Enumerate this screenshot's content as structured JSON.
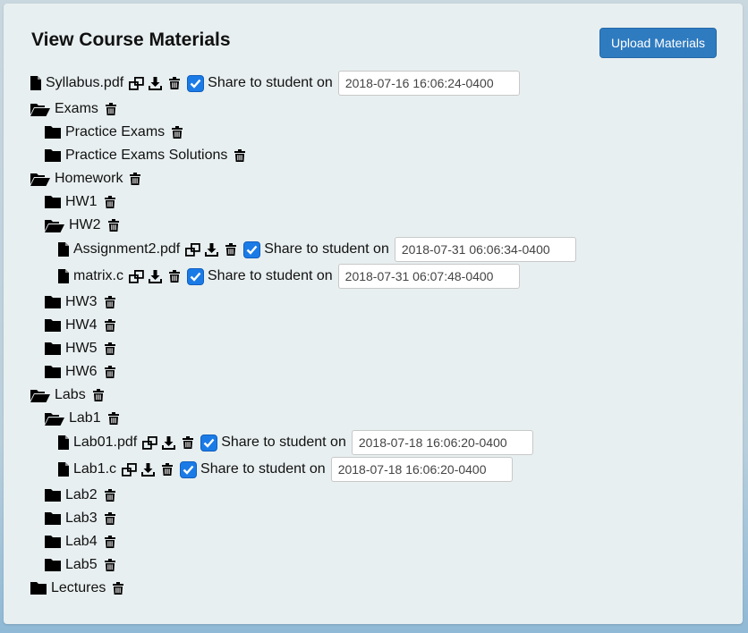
{
  "page": {
    "title": "View Course Materials",
    "upload_label": "Upload Materials"
  },
  "share_label": "Share to student on",
  "tree": {
    "syllabus": {
      "name": "Syllabus.pdf",
      "date": "2018-07-16 16:06:24-0400"
    },
    "exams": {
      "name": "Exams"
    },
    "practice_exams": {
      "name": "Practice Exams"
    },
    "practice_exams_solutions": {
      "name": "Practice Exams Solutions"
    },
    "homework": {
      "name": "Homework"
    },
    "hw1": {
      "name": "HW1"
    },
    "hw2": {
      "name": "HW2"
    },
    "assignment2": {
      "name": "Assignment2.pdf",
      "date": "2018-07-31 06:06:34-0400"
    },
    "matrix": {
      "name": "matrix.c",
      "date": "2018-07-31 06:07:48-0400"
    },
    "hw3": {
      "name": "HW3"
    },
    "hw4": {
      "name": "HW4"
    },
    "hw5": {
      "name": "HW5"
    },
    "hw6": {
      "name": "HW6"
    },
    "labs": {
      "name": "Labs"
    },
    "lab1": {
      "name": "Lab1"
    },
    "lab01_pdf": {
      "name": "Lab01.pdf",
      "date": "2018-07-18 16:06:20-0400"
    },
    "lab1_c": {
      "name": "Lab1.c",
      "date": "2018-07-18 16:06:20-0400"
    },
    "lab2": {
      "name": "Lab2"
    },
    "lab3": {
      "name": "Lab3"
    },
    "lab4": {
      "name": "Lab4"
    },
    "lab5": {
      "name": "Lab5"
    },
    "lectures": {
      "name": "Lectures"
    }
  },
  "colors": {
    "primary_button": "#2f7bc0",
    "checkbox": "#1b7be6",
    "panel": "#e8eff0"
  },
  "icons": [
    "file-icon",
    "folder-icon",
    "folder-open-icon",
    "copy-icon",
    "download-icon",
    "trash-icon",
    "checkbox-checked-icon"
  ]
}
